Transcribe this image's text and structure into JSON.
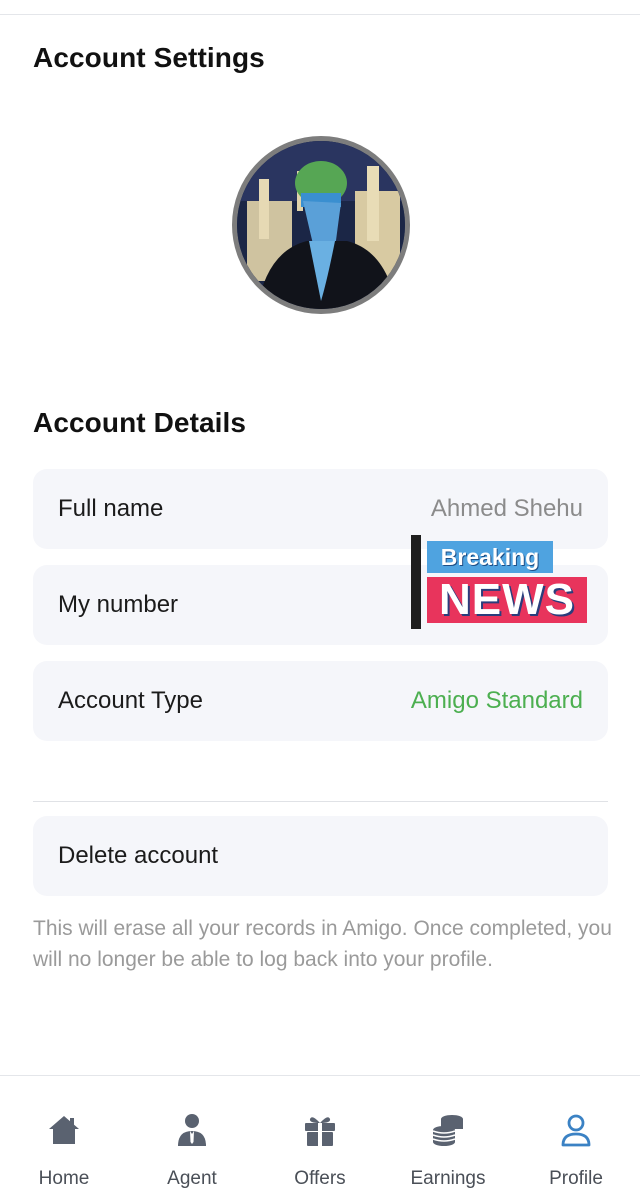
{
  "page": {
    "settings_title": "Account Settings",
    "details_title": "Account Details"
  },
  "profile": {
    "avatar_icon": "profile-photo"
  },
  "details": {
    "full_name_label": "Full name",
    "full_name_value": "Ahmed Shehu",
    "number_label": "My number",
    "number_value": "",
    "account_type_label": "Account Type",
    "account_type_value": "Amigo Standard"
  },
  "delete": {
    "label": "Delete account",
    "note": "This will erase all your records in Amigo. Once completed, you will no longer be able to log back into your profile."
  },
  "sticker": {
    "breaking": "Breaking",
    "news": "NEWS"
  },
  "nav": {
    "items": [
      {
        "label": "Home",
        "icon": "home-icon"
      },
      {
        "label": "Agent",
        "icon": "agent-icon"
      },
      {
        "label": "Offers",
        "icon": "gift-icon"
      },
      {
        "label": "Earnings",
        "icon": "coins-icon"
      },
      {
        "label": "Profile",
        "icon": "user-icon"
      }
    ],
    "active": "Profile"
  },
  "colors": {
    "accent_green": "#4caf50",
    "active_nav": "#3b82c4",
    "nav_icon": "#5a6270",
    "card_bg": "#f5f6fa"
  }
}
